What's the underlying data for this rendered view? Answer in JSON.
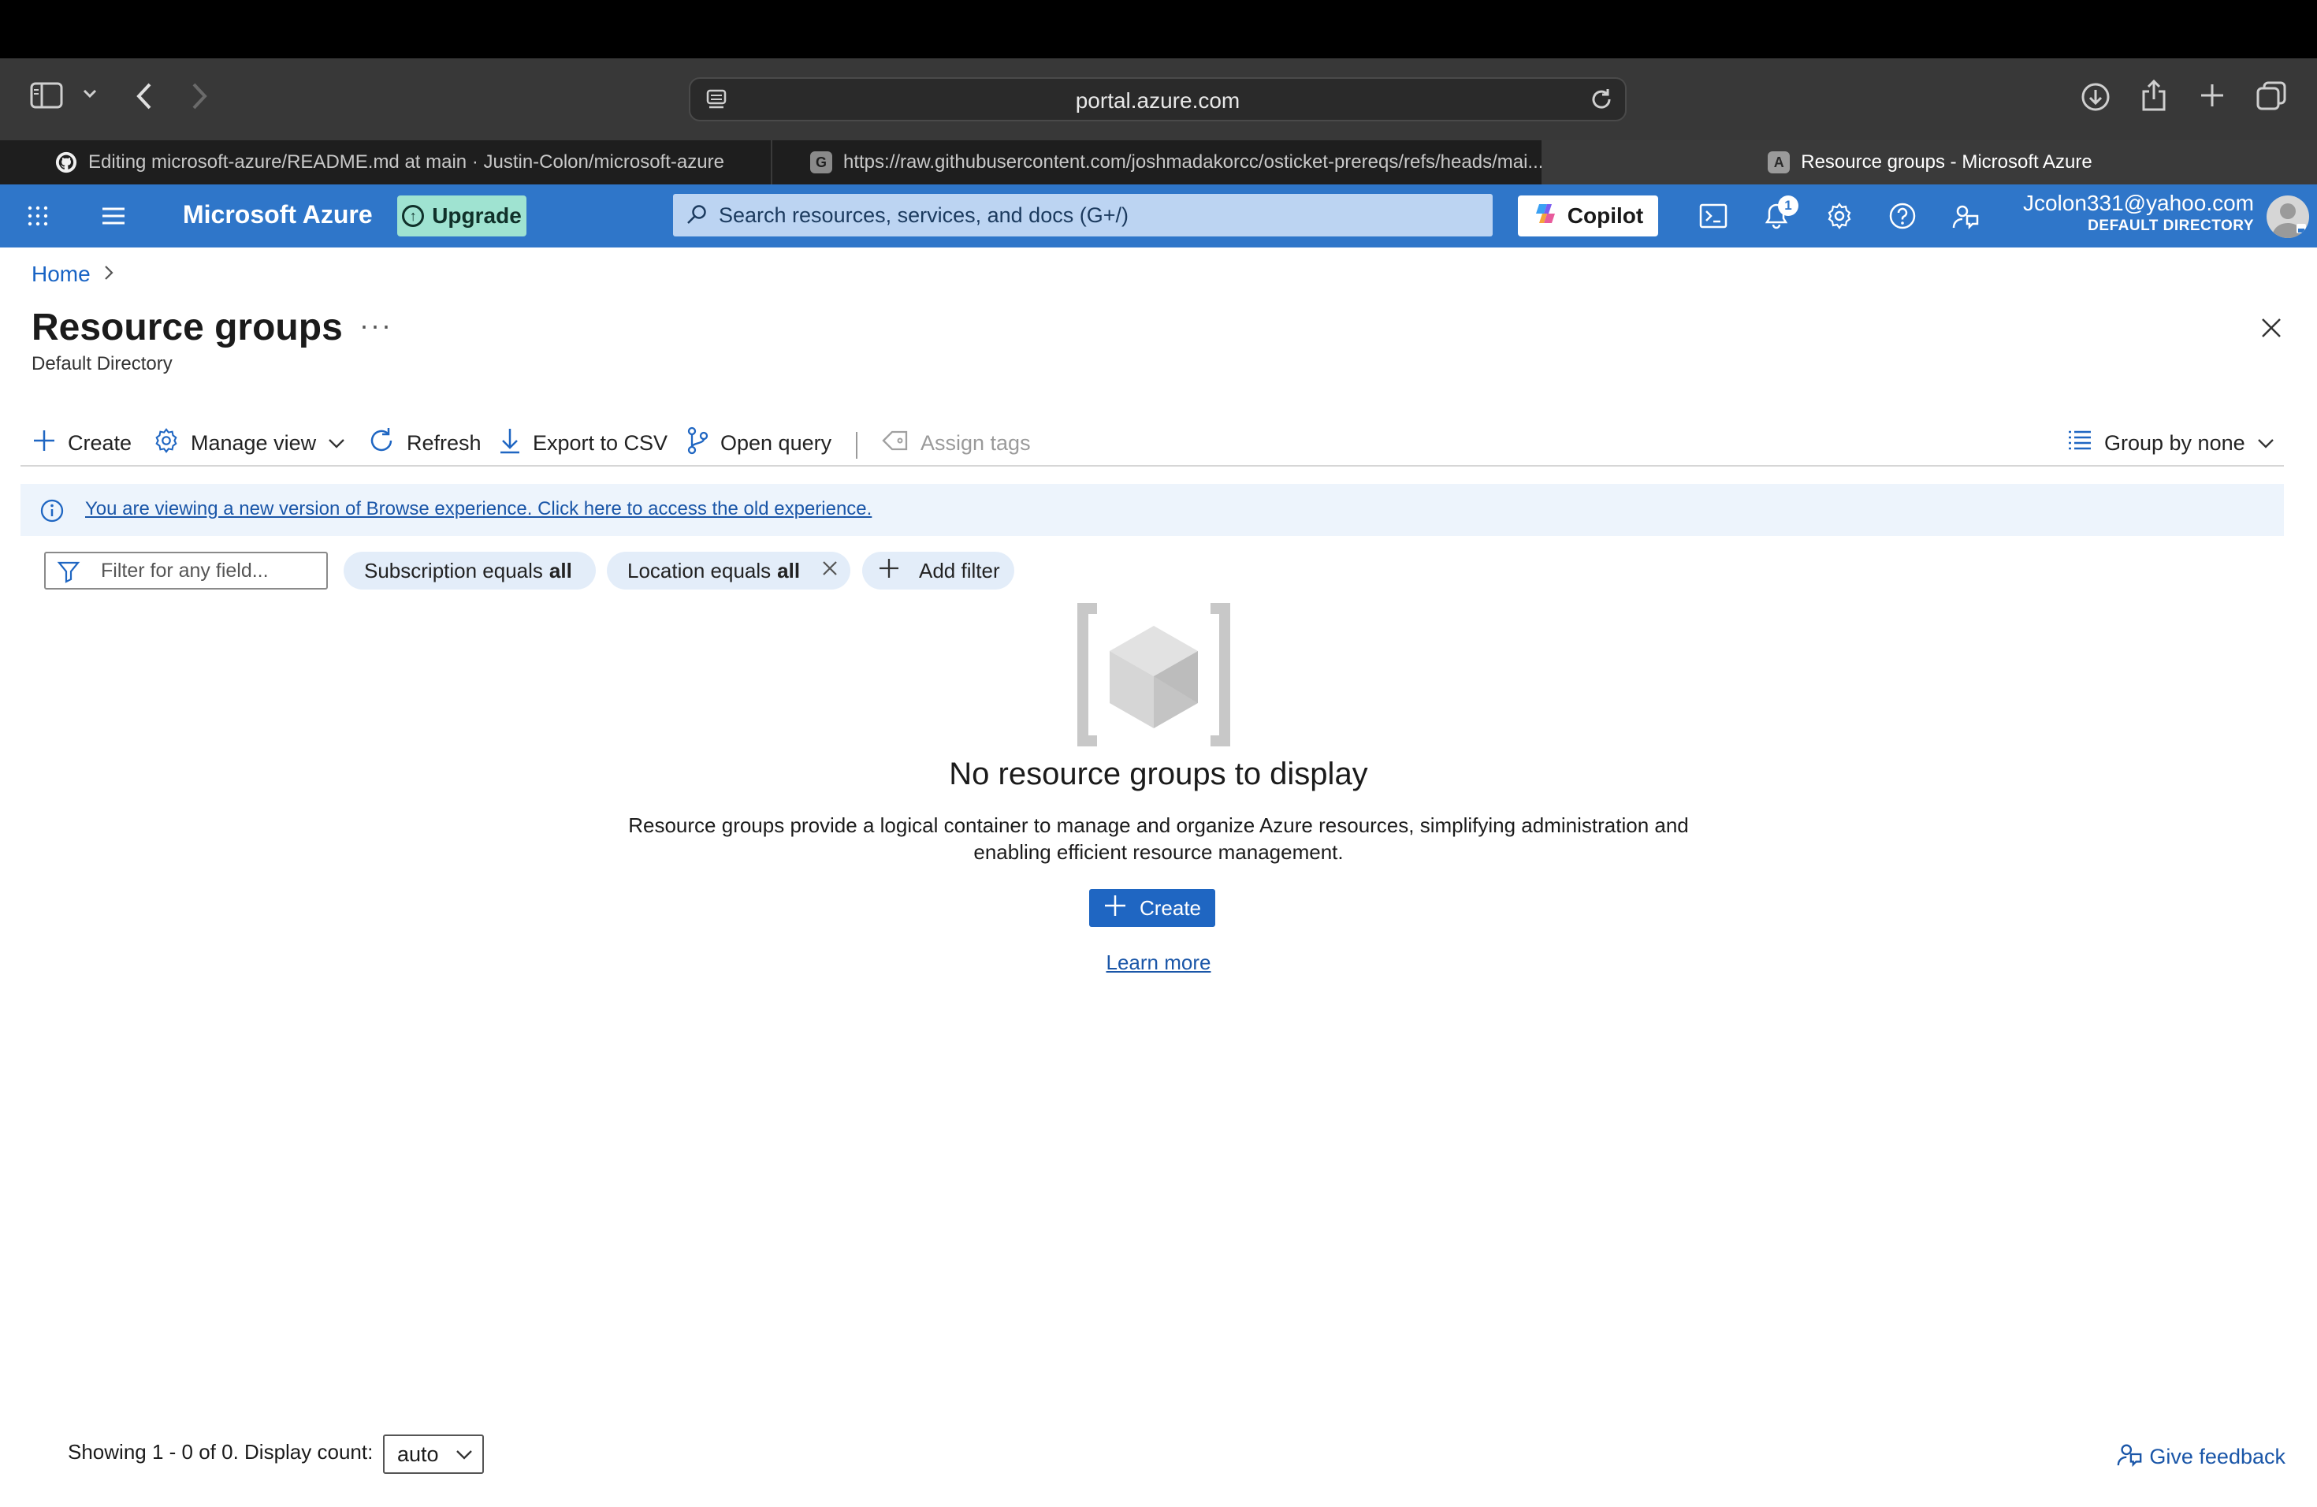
{
  "browser": {
    "address": "portal.azure.com",
    "tabs": [
      {
        "title": "Editing microsoft-azure/README.md at main · Justin-Colon/microsoft-azure",
        "favicon": "github-icon"
      },
      {
        "title": "https://raw.githubusercontent.com/joshmadakorcc/osticket-prereqs/refs/heads/mai...",
        "favicon": "G"
      },
      {
        "title": "Resource groups - Microsoft Azure",
        "favicon": "A"
      }
    ]
  },
  "header": {
    "brand": "Microsoft Azure",
    "upgrade_label": "Upgrade",
    "search_placeholder": "Search resources, services, and docs (G+/)",
    "copilot_label": "Copilot",
    "notification_count": "1",
    "account_email": "Jcolon331@yahoo.com",
    "account_directory": "DEFAULT DIRECTORY",
    "accent_color": "#2f76c9"
  },
  "breadcrumb": {
    "home": "Home"
  },
  "page": {
    "title": "Resource groups",
    "more": "···",
    "subtitle": "Default Directory"
  },
  "commands": {
    "create": "Create",
    "manage_view": "Manage view",
    "refresh": "Refresh",
    "export_csv": "Export to CSV",
    "open_query": "Open query",
    "assign_tags": "Assign tags",
    "group_by": "Group by none"
  },
  "banner": {
    "text": "You are viewing a new version of Browse experience. Click here to access the old experience."
  },
  "filters": {
    "placeholder": "Filter for any field...",
    "subscription_label": "Subscription equals",
    "subscription_value": "all",
    "location_label": "Location equals",
    "location_value": "all",
    "add_filter": "Add filter"
  },
  "empty_state": {
    "title": "No resource groups to display",
    "description_line1": "Resource groups provide a logical container to manage and organize Azure resources, simplifying administration and",
    "description_line2": "enabling efficient resource management.",
    "create_label": "Create",
    "learn_more": "Learn more"
  },
  "footer": {
    "showing": "Showing 1 - 0 of 0. Display count:",
    "display_count": "auto",
    "give_feedback": "Give feedback"
  }
}
